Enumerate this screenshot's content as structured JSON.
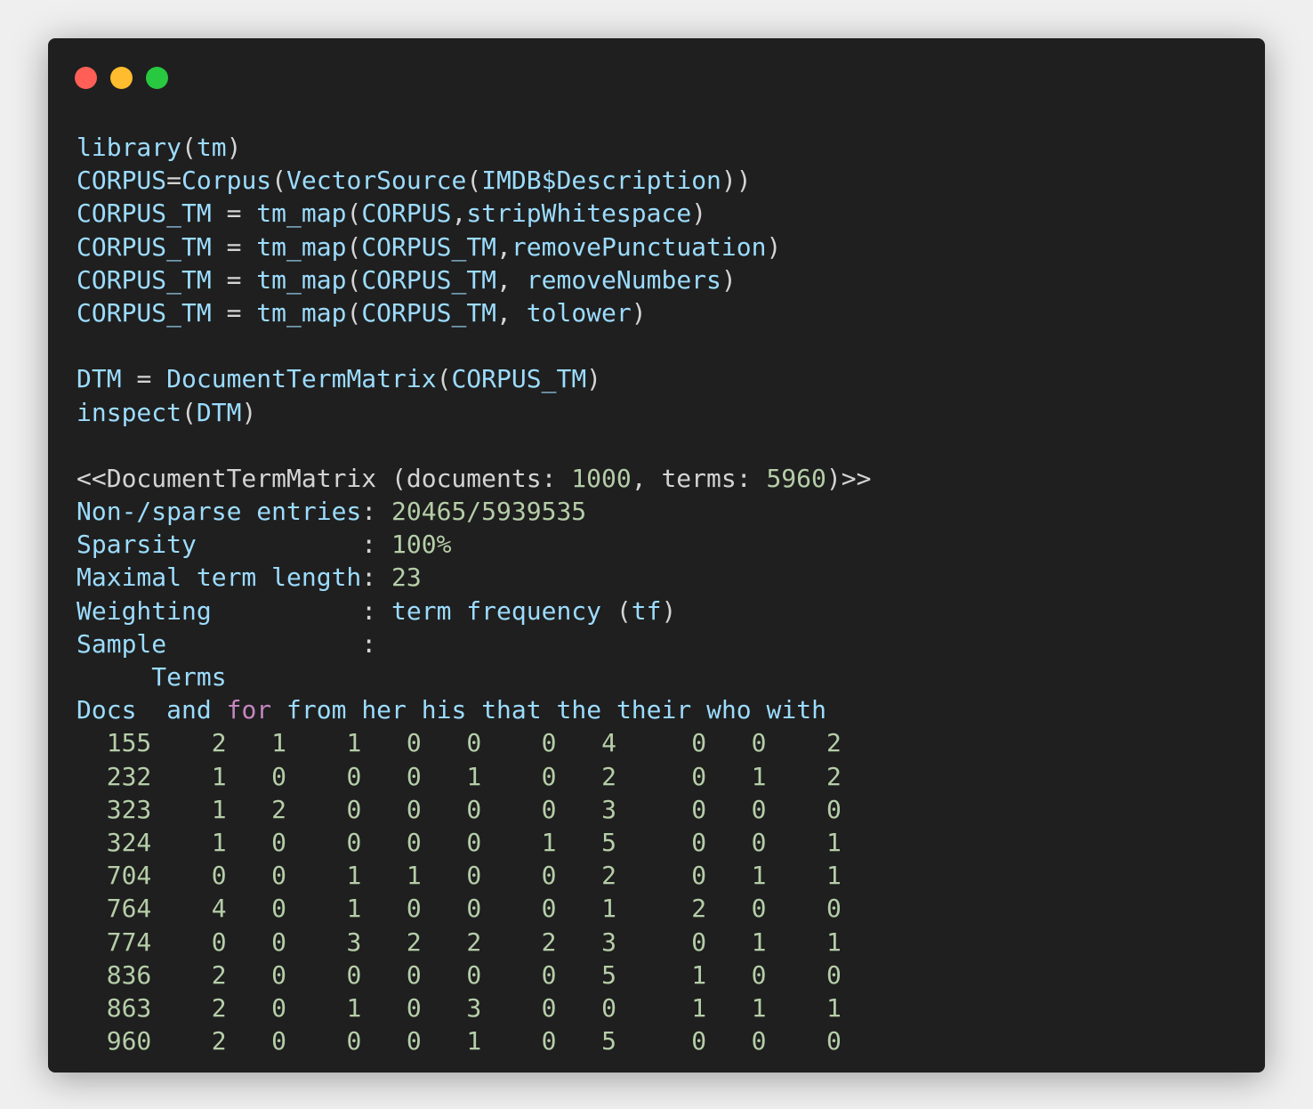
{
  "window": {
    "controls": [
      "close",
      "minimize",
      "maximize"
    ],
    "colors": {
      "close": "#ff5f57",
      "minimize": "#febc2e",
      "maximize": "#28c840",
      "background": "#1f1f1f"
    }
  },
  "code": {
    "lines": [
      "library(tm)",
      "CORPUS=Corpus(VectorSource(IMDB$Description))",
      "CORPUS_TM = tm_map(CORPUS,stripWhitespace)",
      "CORPUS_TM = tm_map(CORPUS_TM,removePunctuation)",
      "CORPUS_TM = tm_map(CORPUS_TM, removeNumbers)",
      "CORPUS_TM = tm_map(CORPUS_TM, tolower)",
      "",
      "DTM = DocumentTermMatrix(CORPUS_TM)",
      "inspect(DTM)"
    ]
  },
  "output": {
    "header": {
      "pre": "<<DocumentTermMatrix (documents: ",
      "documents": "1000",
      "mid": ", terms: ",
      "terms": "5960",
      "post": ")>>"
    },
    "stats": [
      {
        "label": "Non-/sparse entries",
        "value": "20465/5939535"
      },
      {
        "label": "Sparsity",
        "value": "100%"
      },
      {
        "label": "Maximal term length",
        "value": "23"
      },
      {
        "label": "Weighting",
        "value": "term frequency (tf)"
      },
      {
        "label": "Sample",
        "value": ""
      }
    ],
    "terms_label": "Terms",
    "docs_label": "Docs",
    "columns": [
      "and",
      "for",
      "from",
      "her",
      "his",
      "that",
      "the",
      "their",
      "who",
      "with"
    ],
    "rows": [
      {
        "doc": "155",
        "values": [
          "2",
          "1",
          "1",
          "0",
          "0",
          "0",
          "4",
          "0",
          "0",
          "2"
        ]
      },
      {
        "doc": "232",
        "values": [
          "1",
          "0",
          "0",
          "0",
          "1",
          "0",
          "2",
          "0",
          "1",
          "2"
        ]
      },
      {
        "doc": "323",
        "values": [
          "1",
          "2",
          "0",
          "0",
          "0",
          "0",
          "3",
          "0",
          "0",
          "0"
        ]
      },
      {
        "doc": "324",
        "values": [
          "1",
          "0",
          "0",
          "0",
          "0",
          "1",
          "5",
          "0",
          "0",
          "1"
        ]
      },
      {
        "doc": "704",
        "values": [
          "0",
          "0",
          "1",
          "1",
          "0",
          "0",
          "2",
          "0",
          "1",
          "1"
        ]
      },
      {
        "doc": "764",
        "values": [
          "4",
          "0",
          "1",
          "0",
          "0",
          "0",
          "1",
          "2",
          "0",
          "0"
        ]
      },
      {
        "doc": "774",
        "values": [
          "0",
          "0",
          "3",
          "2",
          "2",
          "2",
          "3",
          "0",
          "1",
          "1"
        ]
      },
      {
        "doc": "836",
        "values": [
          "2",
          "0",
          "0",
          "0",
          "0",
          "0",
          "5",
          "1",
          "0",
          "0"
        ]
      },
      {
        "doc": "863",
        "values": [
          "2",
          "0",
          "1",
          "0",
          "3",
          "0",
          "0",
          "1",
          "1",
          "1"
        ]
      },
      {
        "doc": "960",
        "values": [
          "2",
          "0",
          "0",
          "0",
          "1",
          "0",
          "5",
          "0",
          "0",
          "0"
        ]
      }
    ]
  }
}
